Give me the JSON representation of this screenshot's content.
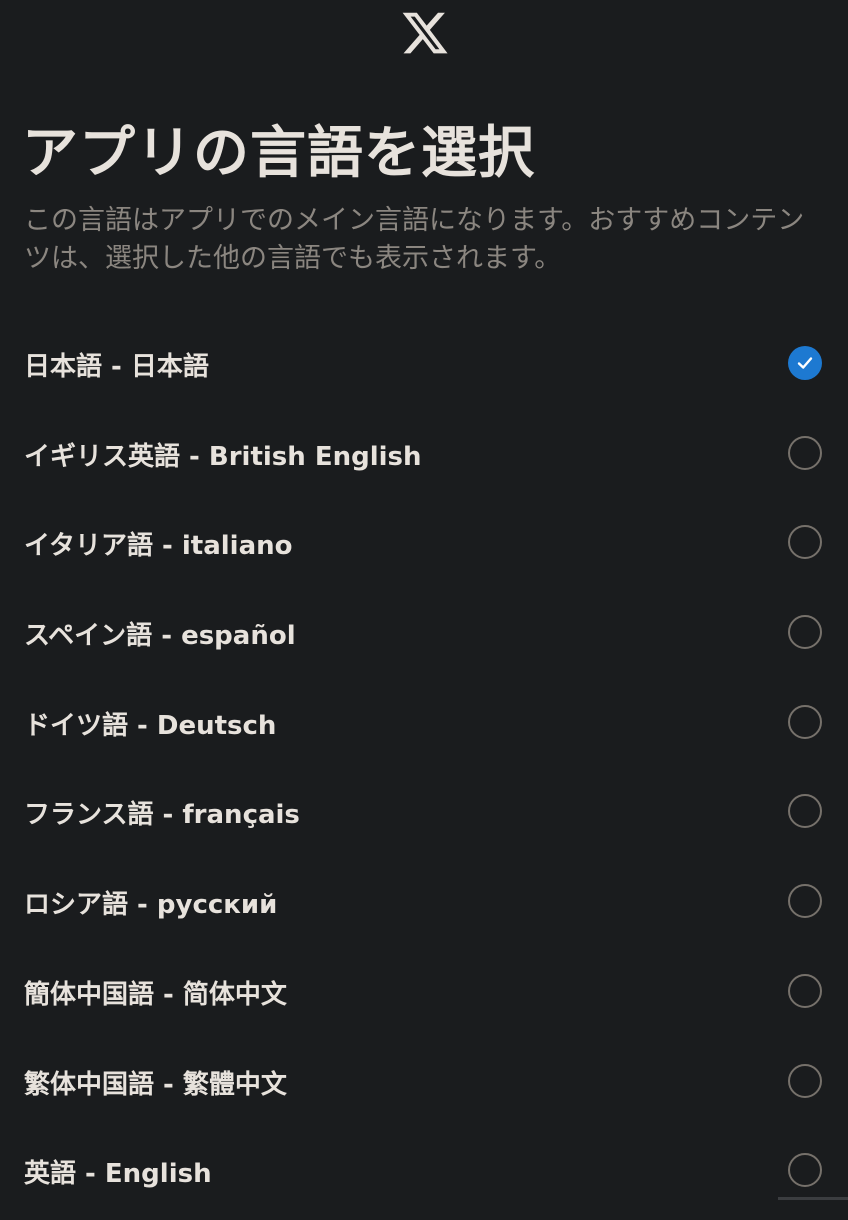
{
  "logo": {
    "icon": "x-logo-icon"
  },
  "header": {
    "title": "アプリの言語を選択",
    "subtitle": "この言語はアプリでのメイン言語になります。おすすめコンテンツは、選択した他の言語でも表示されます。"
  },
  "languages": [
    {
      "label": "日本語 - 日本語",
      "selected": true
    },
    {
      "label": "イギリス英語 - British English",
      "selected": false
    },
    {
      "label": "イタリア語 - italiano",
      "selected": false
    },
    {
      "label": "スペイン語 - español",
      "selected": false
    },
    {
      "label": "ドイツ語 - Deutsch",
      "selected": false
    },
    {
      "label": "フランス語 - français",
      "selected": false
    },
    {
      "label": "ロシア語 - русский",
      "selected": false
    },
    {
      "label": "簡体中国語 - 简体中文",
      "selected": false
    },
    {
      "label": "繁体中国語 - 繁體中文",
      "selected": false
    },
    {
      "label": "英語 - English",
      "selected": false
    }
  ],
  "colors": {
    "background": "#1a1c1e",
    "accent": "#1d79d1",
    "radio_border": "#76716b",
    "text": "#e7e2dc",
    "muted_text": "#8b8680"
  }
}
